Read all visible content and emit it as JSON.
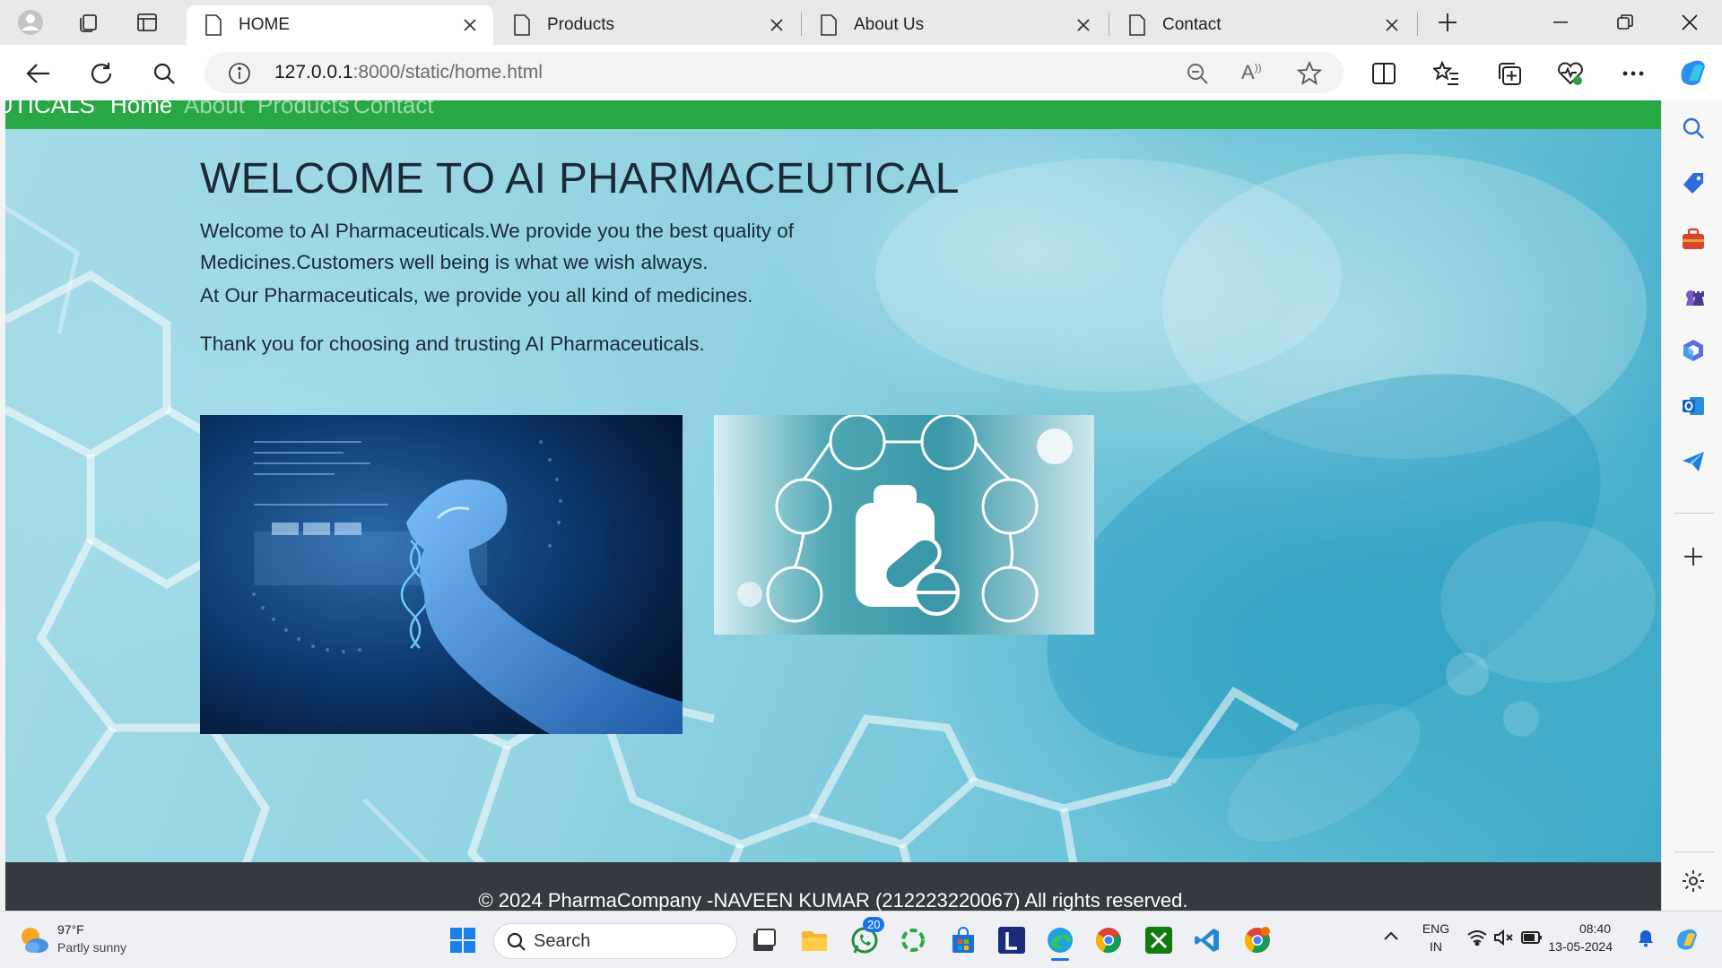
{
  "browser": {
    "tabs": [
      {
        "label": "HOME",
        "active": true
      },
      {
        "label": "Products",
        "active": false
      },
      {
        "label": "About Us",
        "active": false
      },
      {
        "label": "Contact",
        "active": false
      }
    ],
    "url_host": "127.0.0.1",
    "url_path": ":8000/static/home.html"
  },
  "page": {
    "navbar": {
      "brand_fragment": "UTICALS",
      "links": [
        "Home",
        "About",
        "Products",
        "Contact"
      ],
      "color": "#27a844"
    },
    "heading": "WELCOME TO AI PHARMACEUTICAL",
    "paragraph_1": "Welcome to AI Pharmaceuticals.We provide you the best quality of Medicines.Customers well being is what we wish always.",
    "paragraph_2": "At Our Pharmaceuticals, we provide you all kind of medicines.",
    "paragraph_3": "Thank you for choosing and trusting AI Pharmaceuticals.",
    "footer_text": "© 2024 PharmaCompany -NAVEEN KUMAR (212223220067) All rights reserved.",
    "footer_color": "#343a40"
  },
  "taskbar": {
    "weather_temp": "97°F",
    "weather_desc": "Partly sunny",
    "search_label": "Search",
    "whatsapp_badge": "20",
    "lang_line1": "ENG",
    "lang_line2": "IN",
    "time": "08:40",
    "date": "13-05-2024"
  }
}
